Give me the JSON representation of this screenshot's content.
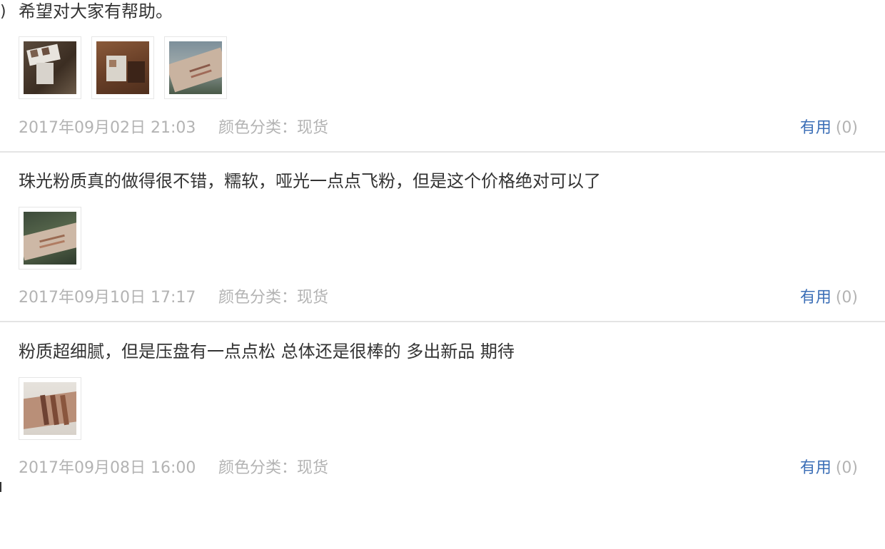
{
  "reviews": [
    {
      "text": "希望对大家有帮助。",
      "lead_mark": ")",
      "image_count": 3,
      "date": "2017年09月02日 21:03",
      "sku": "颜色分类：现货",
      "useful_label": "有用",
      "useful_count": "(0)"
    },
    {
      "text": "珠光粉质真的做得很不错，糯软，哑光一点点飞粉，但是这个价格绝对可以了",
      "image_count": 1,
      "date": "2017年09月10日 17:17",
      "sku": "颜色分类：现货",
      "useful_label": "有用",
      "useful_count": "(0)"
    },
    {
      "text": "粉质超细腻，但是压盘有一点点松 总体还是很棒的 多出新品 期待",
      "image_count": 1,
      "date": "2017年09月08日 16:00",
      "sku": "颜色分类：现货",
      "useful_label": "有用",
      "useful_count": "(0)"
    }
  ],
  "colors": {
    "text": "#333333",
    "meta": "#b3b3b3",
    "link": "#3c6fb7",
    "divider": "#e4e4e4",
    "thumb_border": "#e6e6e6"
  }
}
